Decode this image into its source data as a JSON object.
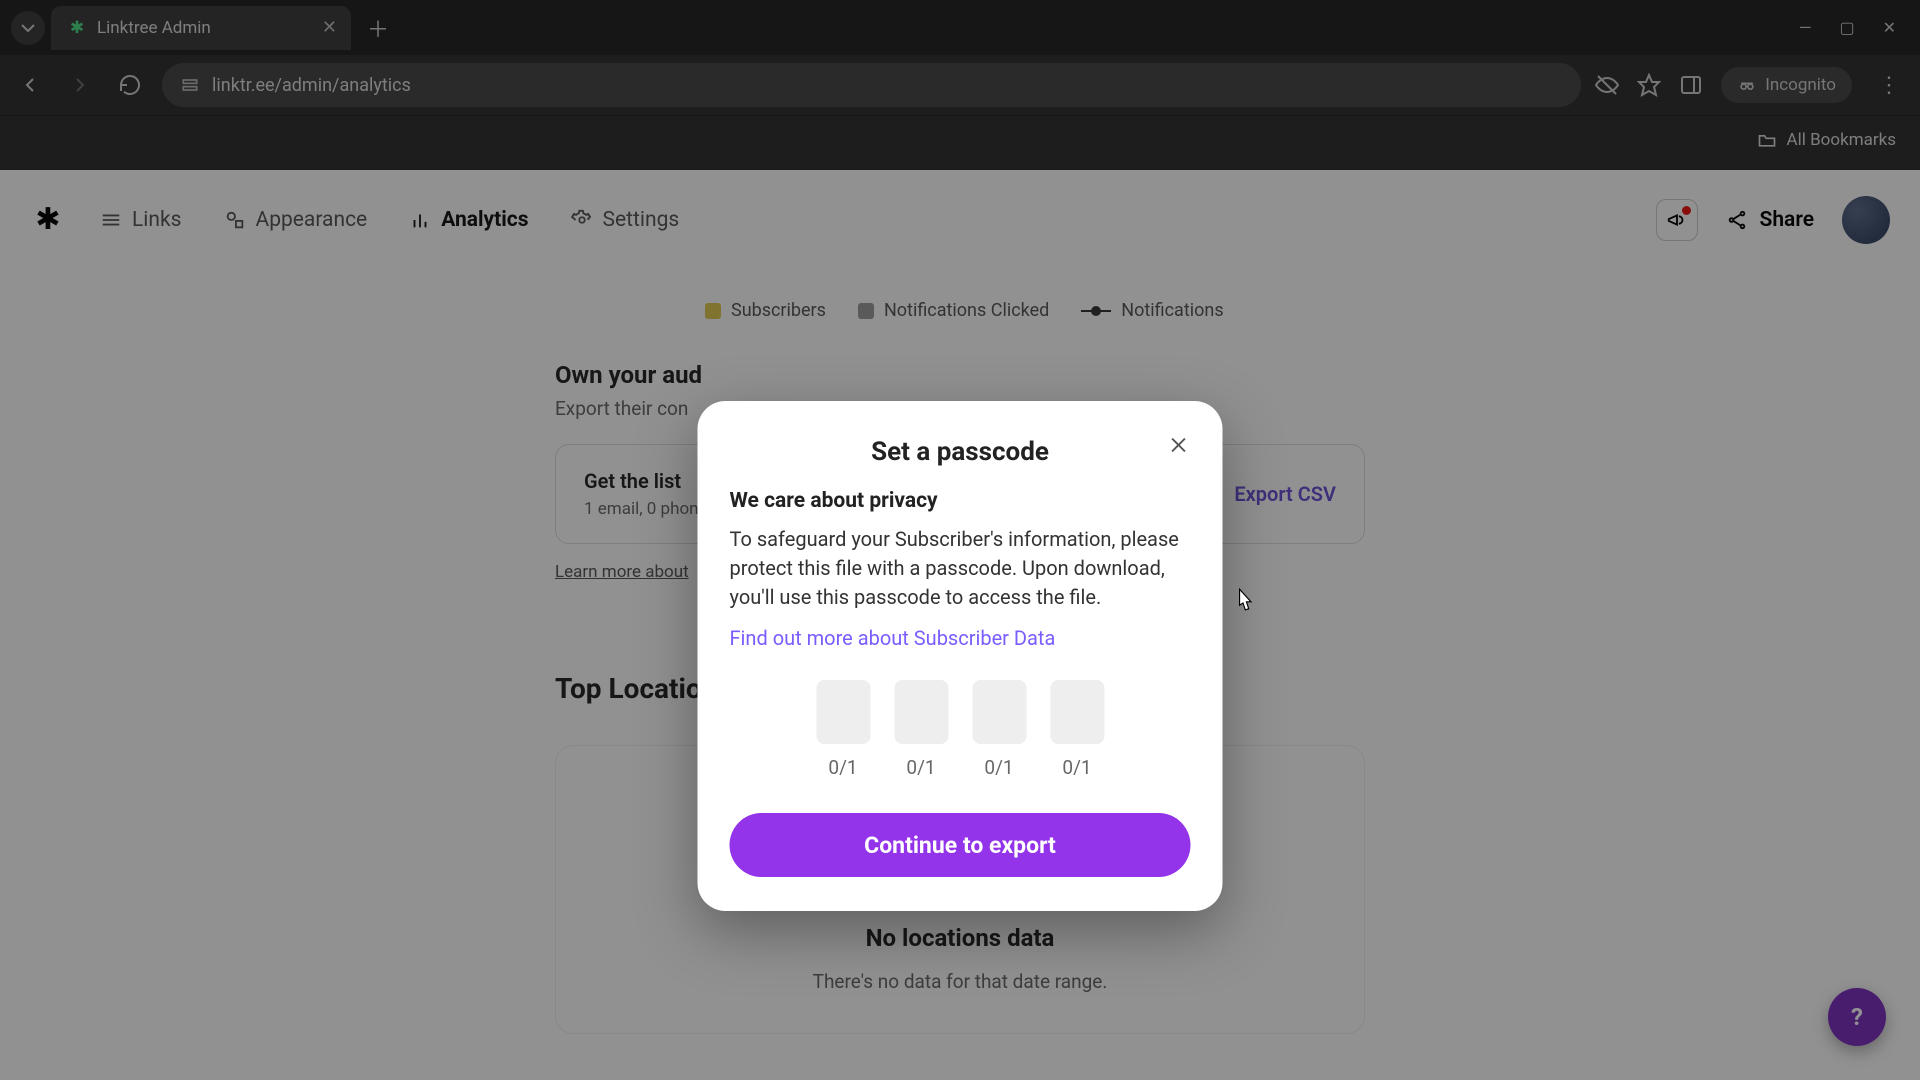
{
  "browser": {
    "tab_title": "Linktree Admin",
    "url": "linktr.ee/admin/analytics",
    "incognito_label": "Incognito",
    "all_bookmarks": "All Bookmarks"
  },
  "nav": {
    "links": "Links",
    "appearance": "Appearance",
    "analytics": "Analytics",
    "settings": "Settings",
    "share": "Share"
  },
  "legend": {
    "subscribers": "Subscribers",
    "notifications_clicked": "Notifications Clicked",
    "notifications": "Notifications"
  },
  "own": {
    "title": "Own your aud",
    "subtitle": "Export their con",
    "get_the_list": "Get the list",
    "stats": "1 email, 0 phon",
    "export_csv": "Export CSV",
    "learn_more": "Learn more about"
  },
  "locations": {
    "title": "Top Locations",
    "empty_title": "No locations data",
    "empty_sub": "There's no data for that date range."
  },
  "modal": {
    "title": "Set a passcode",
    "privacy_heading": "We care about privacy",
    "body": "To safeguard your Subscriber's information, please protect this file with a passcode. Upon download, you'll use this passcode to access the file.",
    "link": "Find out more about Subscriber Data",
    "counts": [
      "0/1",
      "0/1",
      "0/1",
      "0/1"
    ],
    "cta": "Continue to export"
  },
  "help": "?"
}
